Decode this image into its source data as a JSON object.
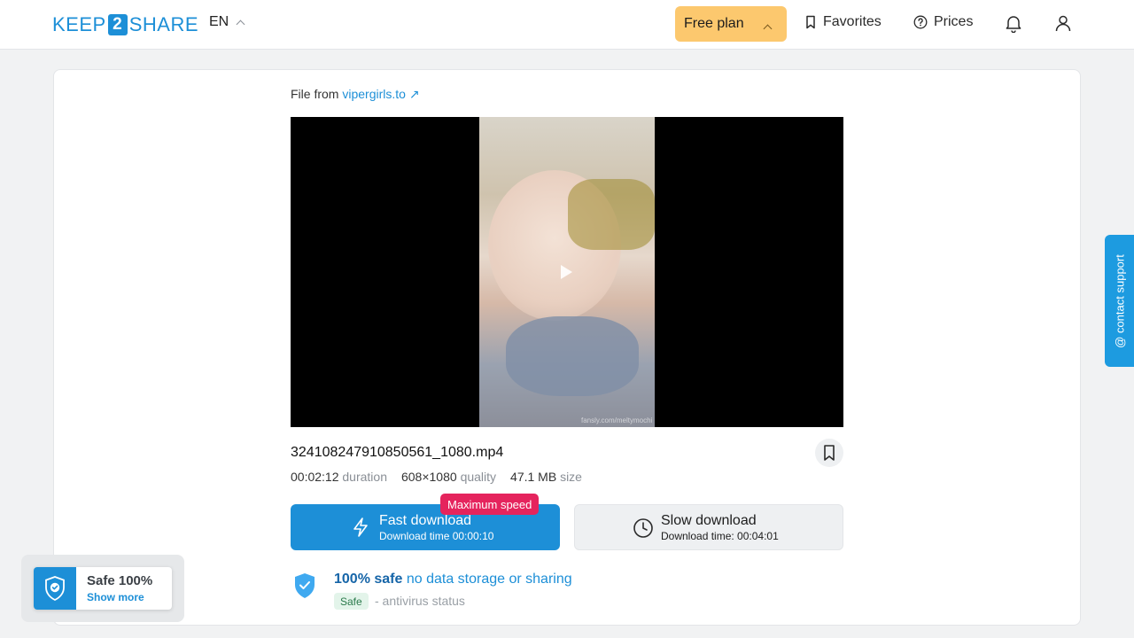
{
  "header": {
    "logo": {
      "left": "KEEP",
      "mid": "2",
      "right": "SHARE"
    },
    "language": "EN",
    "plan_label": "Free plan",
    "favorites_label": "Favorites",
    "prices_label": "Prices"
  },
  "file": {
    "from_prefix": "File from",
    "source": "vipergirls.to",
    "source_arrow": "↗",
    "name": "324108247910850561_1080.mp4",
    "duration": "00:02:12",
    "duration_label": "duration",
    "quality": "608×1080",
    "quality_label": "quality",
    "size": "47.1 MB",
    "size_label": "size",
    "watermark": "fansly.com/meltymochi"
  },
  "download": {
    "fast_label": "Fast download",
    "fast_time": "Download time 00:00:10",
    "max_badge": "Maximum speed",
    "slow_label": "Slow download",
    "slow_time": "Download time: 00:04:01"
  },
  "safety": {
    "title_bold": "100% safe",
    "title_rest": "no data storage or sharing",
    "tag": "Safe",
    "subtitle": "- antivirus status"
  },
  "safe_widget": {
    "title": "Safe 100%",
    "link": "Show more"
  },
  "contact_support": "@ contact support",
  "colors": {
    "brand": "#1d8fd7",
    "plan": "#fcc86e",
    "badge": "#e5245d"
  }
}
